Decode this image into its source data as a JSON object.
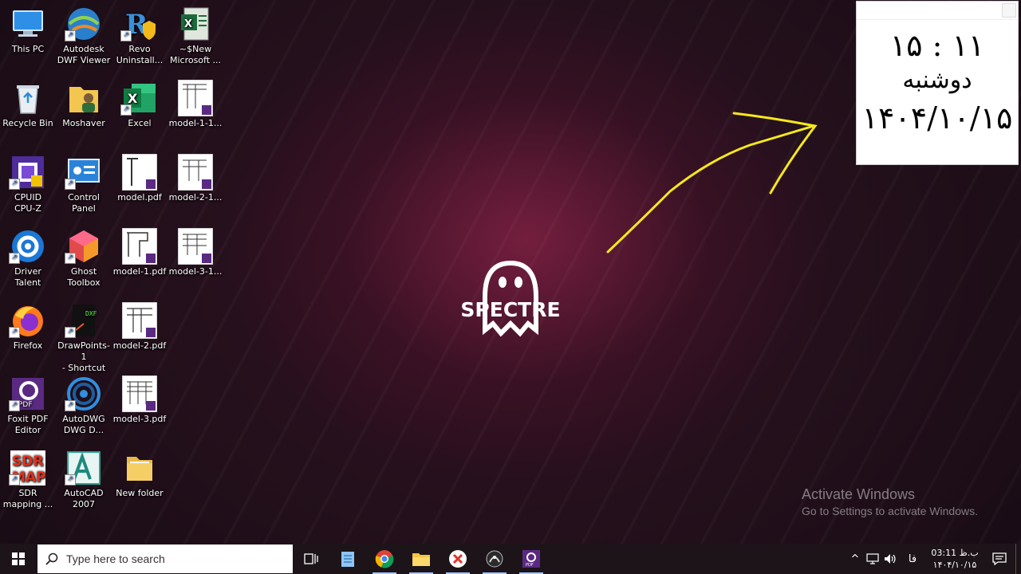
{
  "desktop": {
    "icons": [
      {
        "label": "This PC",
        "icon": "this-pc-icon"
      },
      {
        "label": "Autodesk\nDWF Viewer",
        "icon": "dwf-viewer-icon"
      },
      {
        "label": "Revo\nUninstall...",
        "icon": "revo-uninstaller-icon"
      },
      {
        "label": "~$New\nMicrosoft ...",
        "icon": "excel-file-icon"
      },
      {
        "label": "Recycle Bin",
        "icon": "recycle-bin-icon"
      },
      {
        "label": "Moshaver",
        "icon": "user-folder-icon"
      },
      {
        "label": "Excel",
        "icon": "excel-icon"
      },
      {
        "label": "model-1-1...",
        "icon": "pdf-file-icon"
      },
      {
        "label": "CPUID\nCPU-Z",
        "icon": "cpuz-icon"
      },
      {
        "label": "Control\nPanel",
        "icon": "control-panel-icon"
      },
      {
        "label": "model.pdf",
        "icon": "pdf-file-icon"
      },
      {
        "label": "model-2-1...",
        "icon": "pdf-file-icon"
      },
      {
        "label": "Driver Talent",
        "icon": "driver-talent-icon"
      },
      {
        "label": "Ghost\nToolbox",
        "icon": "ghost-toolbox-icon"
      },
      {
        "label": "model-1.pdf",
        "icon": "pdf-file-icon"
      },
      {
        "label": "model-3-1...",
        "icon": "pdf-file-icon"
      },
      {
        "label": "Firefox",
        "icon": "firefox-icon"
      },
      {
        "label": "DrawPoints-1\n- Shortcut",
        "icon": "drawpoints-icon"
      },
      {
        "label": "model-2.pdf",
        "icon": "pdf-file-icon"
      },
      {
        "label": "Foxit PDF\nEditor",
        "icon": "foxit-pdf-icon"
      },
      {
        "label": "AutoDWG\nDWG D...",
        "icon": "autodwg-icon"
      },
      {
        "label": "model-3.pdf",
        "icon": "pdf-file-icon"
      },
      {
        "label": "SDR\nmapping ...",
        "icon": "sdr-map-icon"
      },
      {
        "label": "AutoCAD\n2007",
        "icon": "autocad-icon"
      },
      {
        "label": "New folder",
        "icon": "folder-icon"
      }
    ],
    "logo_text": "SPECTRE",
    "activate": {
      "title": "Activate Windows",
      "subtitle": "Go to Settings to activate Windows."
    },
    "annotation": {
      "color": "#f5e81c",
      "shape": "arrow"
    }
  },
  "clock_widget": {
    "time": "۱۵ : ۱۱",
    "day": "دوشنبه",
    "date": "۱۴۰۴/۱۰/۱۵"
  },
  "taskbar": {
    "search_placeholder": "Type here to search",
    "apps": [
      "task-view-icon",
      "notepad-icon",
      "chrome-icon",
      "file-explorer-icon",
      "xmind-icon",
      "satellite-app-icon",
      "foxit-pdf-icon"
    ],
    "tray": {
      "language": "فا",
      "time": "ب.ظ 03:11",
      "date": "۱۴۰۴/۱۰/۱۵"
    }
  },
  "colors": {
    "taskbar_bg": "#1c1418",
    "accent_underline": "#a6c8ff",
    "wallpaper_glow": "#872346"
  }
}
